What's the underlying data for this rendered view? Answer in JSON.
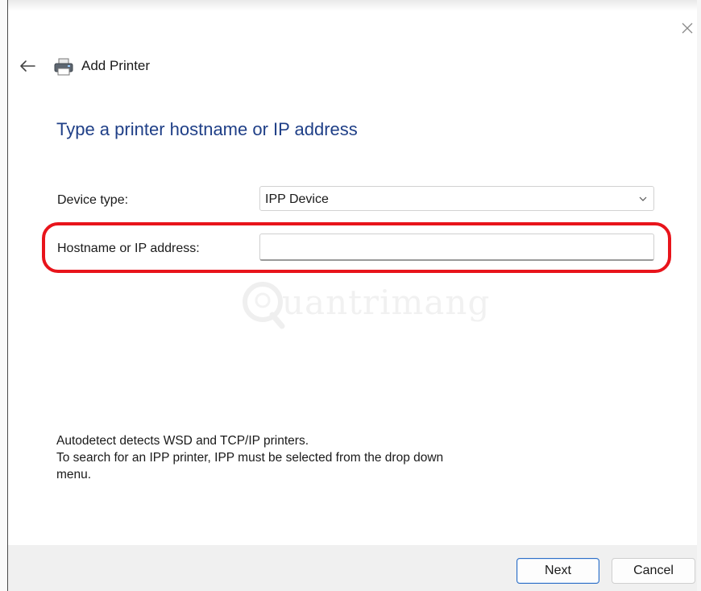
{
  "window": {
    "title": "Add Printer",
    "icons": {
      "close": "close-icon",
      "back": "back-arrow-icon",
      "app": "printer-icon"
    }
  },
  "page": {
    "heading": "Type a printer hostname or IP address"
  },
  "form": {
    "device_type_label": "Device type:",
    "device_type_value": "IPP Device",
    "hostname_label": "Hostname or IP address:",
    "hostname_value": ""
  },
  "info": {
    "line1": "Autodetect detects WSD and TCP/IP printers.",
    "line2": "To search for an IPP printer, IPP must be selected from the drop down",
    "line3": "menu."
  },
  "watermark": {
    "text": "uantrimang"
  },
  "buttons": {
    "next": "Next",
    "cancel": "Cancel"
  },
  "colors": {
    "heading": "#1f3f87",
    "highlight": "#e8141b",
    "default_button_border": "#2e6fc7",
    "footer_bg": "#f0f0f0"
  }
}
